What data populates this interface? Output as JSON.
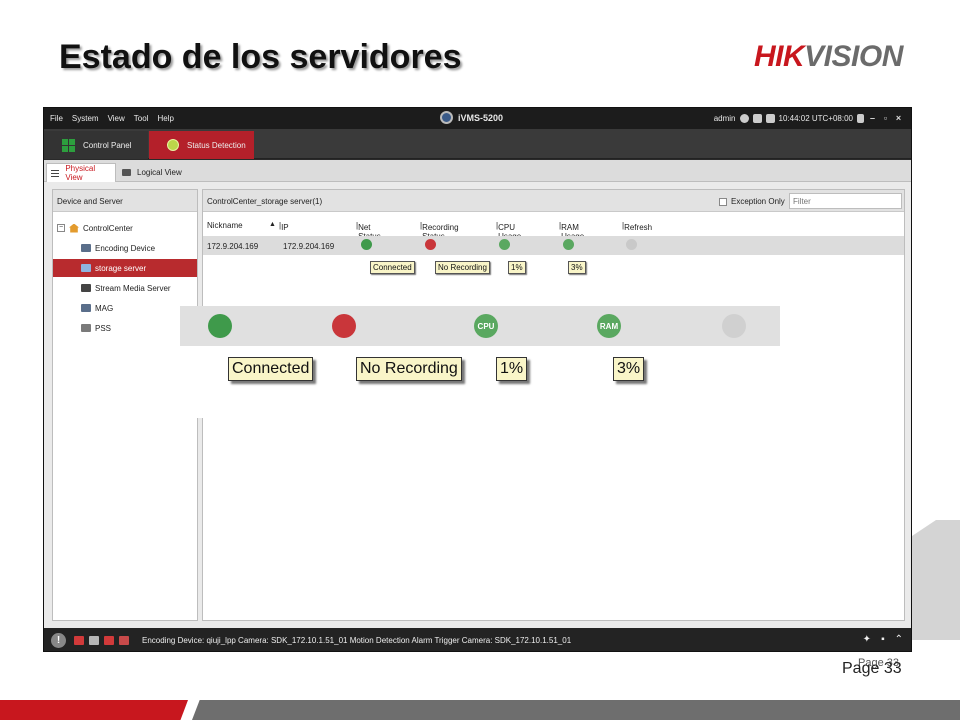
{
  "slide": {
    "title": "Estado de los servidores",
    "logo_hik": "HIK",
    "logo_vision": "VISION",
    "page_label": "Page 33",
    "page_ghost": "Page 33"
  },
  "app": {
    "menu": [
      "File",
      "System",
      "View",
      "Tool",
      "Help"
    ],
    "app_name": "iVMS-5200",
    "user": "admin",
    "time": "10:44:02 UTC+08:00",
    "tabs": {
      "control_panel": "Control Panel",
      "status_detection": "Status Detection"
    },
    "subtabs": {
      "physical": "Physical View",
      "logical": "Logical View"
    },
    "left_panel": {
      "header": "Device and Server",
      "root": "ControlCenter",
      "items": [
        "Encoding Device",
        "storage server",
        "Stream Media Server",
        "MAG",
        "PSS"
      ],
      "selected": "storage server"
    },
    "right_panel": {
      "title": "ControlCenter_storage server(1)",
      "exception_only": "Exception Only",
      "filter_placeholder": "Filter",
      "columns": [
        "Nickname",
        "IP",
        "Net Status",
        "Recording Status",
        "CPU Usage",
        "RAM Usage",
        "Refresh"
      ],
      "row": {
        "nickname": "172.9.204.169",
        "ip": "172.9.204.169"
      },
      "tooltips": {
        "net": "Connected",
        "recording": "No Recording",
        "cpu": "1%",
        "ram": "3%"
      },
      "icon_text": {
        "cpu": "CPU",
        "ram": "RAM"
      }
    },
    "statusbar": {
      "message": "Encoding Device: qiuji_lpp Camera: SDK_172.10.1.51_01 Motion Detection Alarm Trigger Camera: SDK_172.10.1.51_01"
    }
  },
  "colors": {
    "accent_red": "#c8171e",
    "tab_red": "#b4202a",
    "net_green": "#3f9a4b",
    "rec_red": "#c9363a",
    "cpu_green": "#5aa860",
    "ram_green": "#5aa860",
    "refresh_grey": "#c9c9c9"
  }
}
